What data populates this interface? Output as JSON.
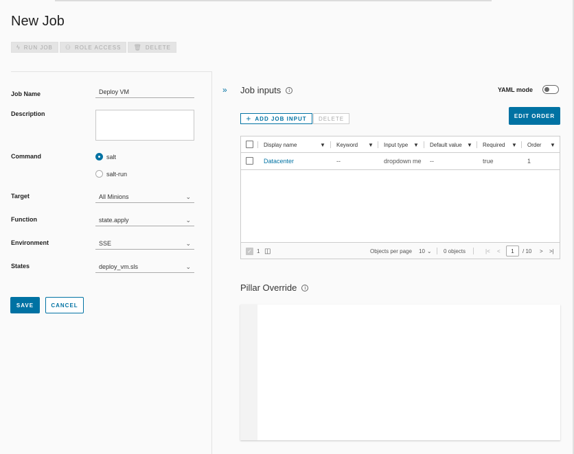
{
  "page": {
    "title": "New Job",
    "actions": [
      {
        "label": "RUN JOB",
        "icon": "lightning-icon"
      },
      {
        "label": "ROLE ACCESS",
        "icon": "users-icon"
      },
      {
        "label": "DELETE",
        "icon": "trash-icon"
      }
    ]
  },
  "form": {
    "job_name_label": "Job Name",
    "job_name_value": "Deploy VM",
    "description_label": "Description",
    "description_value": "",
    "command_label": "Command",
    "command_options": [
      "salt",
      "salt-run"
    ],
    "command_selected": "salt",
    "target_label": "Target",
    "target_value": "All Minions",
    "function_label": "Function",
    "function_value": "state.apply",
    "environment_label": "Environment",
    "environment_value": "SSE",
    "states_label": "States",
    "states_value": "deploy_vm.sls",
    "save_label": "SAVE",
    "cancel_label": "CANCEL"
  },
  "job_inputs": {
    "title": "Job inputs",
    "yaml_mode_label": "YAML mode",
    "yaml_mode_on": false,
    "edit_order_label": "EDIT ORDER",
    "add_input_label": "ADD JOB INPUT",
    "delete_label": "DELETE",
    "columns": [
      "Display name",
      "Keyword",
      "Input type",
      "Default value",
      "Required",
      "Order"
    ],
    "rows": [
      {
        "display_name": "Datacenter",
        "keyword": "--",
        "input_type": "dropdown me",
        "default_value": "--",
        "required": "true",
        "order": "1"
      }
    ],
    "footer": {
      "selected_count": "1",
      "objects_per_page_label": "Objects per page",
      "objects_per_page_value": "10",
      "objects_count": "0 objects",
      "current_page": "1",
      "total_pages": "/ 10"
    }
  },
  "pillar_override": {
    "title": "Pillar Override"
  },
  "colors": {
    "accent": "#0072a3",
    "disabled": "#e4e4e4"
  }
}
